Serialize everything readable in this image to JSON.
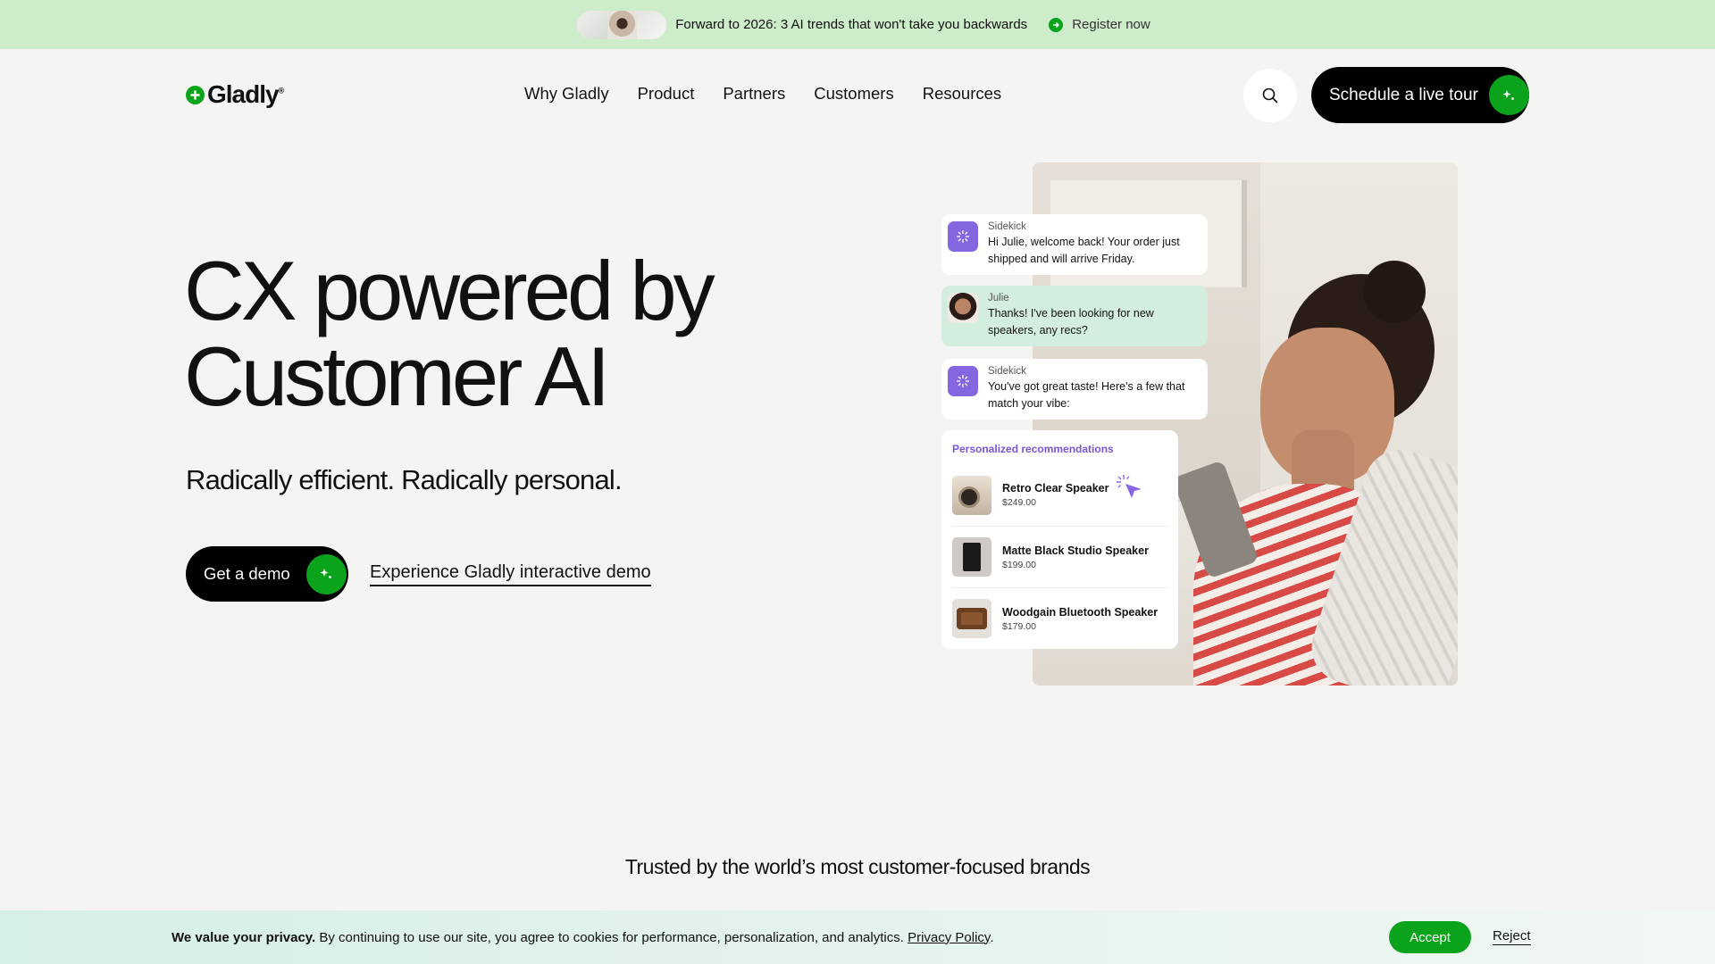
{
  "announcement": {
    "text": "Forward to 2026: 3 AI trends that won't take you backwards",
    "link": "Register now"
  },
  "header": {
    "logo_text": "Gladly",
    "logo_reg": "®",
    "nav": [
      "Why Gladly",
      "Product",
      "Partners",
      "Customers",
      "Resources"
    ],
    "cta_label": "Schedule a live tour"
  },
  "hero": {
    "title_line1": "CX powered by",
    "title_line2": "Customer AI",
    "subtitle": "Radically efficient. Radically personal.",
    "primary_cta": "Get a demo",
    "secondary_cta": "Experience Gladly interactive demo"
  },
  "chat": {
    "messages": [
      {
        "sender": "Sidekick",
        "text": "Hi Julie, welcome back! Your order just shipped and will arrive Friday."
      },
      {
        "sender": "Julie",
        "text": "Thanks! I've been looking for new speakers, any recs?"
      },
      {
        "sender": "Sidekick",
        "text": "You've got great taste! Here's a few that match your vibe:"
      }
    ],
    "recommendations_title": "Personalized recommendations",
    "products": [
      {
        "name": "Retro Clear Speaker",
        "price": "$249.00"
      },
      {
        "name": "Matte Black Studio Speaker",
        "price": "$199.00"
      },
      {
        "name": "Woodgain Bluetooth Speaker",
        "price": "$179.00"
      }
    ]
  },
  "trusted": "Trusted by the world’s most customer-focused brands",
  "cookie": {
    "bold": "We value your privacy.",
    "text": " By continuing to use our site, you agree to cookies for performance, personalization, and analytics. ",
    "policy_link": "Privacy Policy",
    "period": ".",
    "accept": "Accept",
    "reject": "Reject"
  },
  "colors": {
    "brand_green": "#0aa31b",
    "announcement_bg": "#cdecc9",
    "sidekick_purple": "#8366e0",
    "user_bubble": "#d3eede"
  }
}
